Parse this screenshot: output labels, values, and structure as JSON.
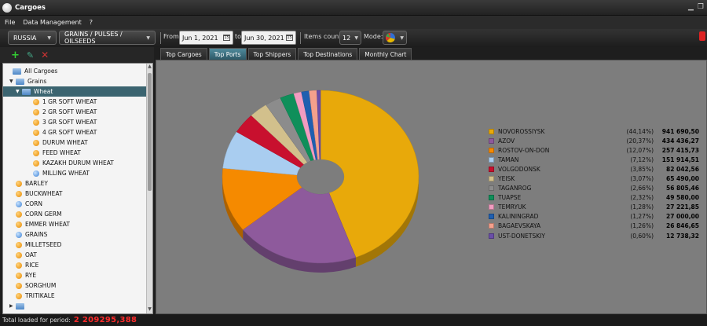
{
  "window": {
    "title": "Cargoes",
    "min_icon": "minimize-icon",
    "restore_icon": "restore-icon"
  },
  "menu": {
    "items": [
      "File",
      "Data Management",
      "?"
    ]
  },
  "toolbar": {
    "country": "RUSSIA",
    "category": "GRAINS / PULSES / OILSEEDS",
    "from_label": "From",
    "from_date": "Jun 1, 2021",
    "to_label": "to",
    "to_date": "Jun 30, 2021",
    "items_count_label": "Items count:",
    "items_count": "12",
    "mode_label": "Mode:",
    "mode_icon": "pie-chart-icon"
  },
  "tree": {
    "items": [
      {
        "label": "All Cargoes",
        "level": 0,
        "icon": "folder",
        "expand": ""
      },
      {
        "label": "Grains",
        "level": 1,
        "icon": "folder",
        "expand": "▼"
      },
      {
        "label": "Wheat",
        "level": 2,
        "icon": "folder",
        "expand": "▼",
        "selected": true
      },
      {
        "label": "1 GR SOFT WHEAT",
        "level": 3,
        "icon": "orange"
      },
      {
        "label": "2 GR SOFT WHEAT",
        "level": 3,
        "icon": "orange"
      },
      {
        "label": "3 GR SOFT WHEAT",
        "level": 3,
        "icon": "orange"
      },
      {
        "label": "4 GR SOFT WHEAT",
        "level": 3,
        "icon": "orange"
      },
      {
        "label": "DURUM WHEAT",
        "level": 3,
        "icon": "orange"
      },
      {
        "label": "FEED WHEAT",
        "level": 3,
        "icon": "orange"
      },
      {
        "label": "KAZAKH DURUM WHEAT",
        "level": 3,
        "icon": "orange"
      },
      {
        "label": "MILLING WHEAT",
        "level": 3,
        "icon": "blue"
      },
      {
        "label": "BARLEY",
        "level": 2,
        "icon": "orange"
      },
      {
        "label": "BUCKWHEAT",
        "level": 2,
        "icon": "orange"
      },
      {
        "label": "CORN",
        "level": 2,
        "icon": "blue"
      },
      {
        "label": "CORN GERM",
        "level": 2,
        "icon": "orange"
      },
      {
        "label": "EMMER WHEAT",
        "level": 2,
        "icon": "orange"
      },
      {
        "label": "GRAINS",
        "level": 2,
        "icon": "blue"
      },
      {
        "label": "MILLETSEED",
        "level": 2,
        "icon": "orange"
      },
      {
        "label": "OAT",
        "level": 2,
        "icon": "orange"
      },
      {
        "label": "RICE",
        "level": 2,
        "icon": "orange"
      },
      {
        "label": "RYE",
        "level": 2,
        "icon": "orange"
      },
      {
        "label": "SORGHUM",
        "level": 2,
        "icon": "orange"
      },
      {
        "label": "TRITIKALE",
        "level": 2,
        "icon": "orange"
      },
      {
        "label": "",
        "level": 1,
        "icon": "folder",
        "expand": "▶"
      }
    ]
  },
  "tabs": [
    {
      "label": "Top Cargoes",
      "active": false
    },
    {
      "label": "Top Ports",
      "active": true
    },
    {
      "label": "Top Shippers",
      "active": false
    },
    {
      "label": "Top Destinations",
      "active": false
    },
    {
      "label": "Monthly Chart",
      "active": false
    }
  ],
  "status": {
    "label": "Total loaded for period:",
    "value": "2 209295,388"
  },
  "chart_data": {
    "type": "pie",
    "title": "",
    "donut": true,
    "legend_position": "right",
    "series": [
      {
        "name": "NOVOROSSIYSK",
        "pct_label": "(44,14%)",
        "value_label": "941 690,50",
        "value": 941690.5,
        "color": "#e8a90a"
      },
      {
        "name": "AZOV",
        "pct_label": "(20,37%)",
        "value_label": "434 436,27",
        "value": 434436.27,
        "color": "#8e5a9c"
      },
      {
        "name": "ROSTOV-ON-DON",
        "pct_label": "(12,07%)",
        "value_label": "257 415,73",
        "value": 257415.73,
        "color": "#f58a00"
      },
      {
        "name": "TAMAN",
        "pct_label": "(7,12%)",
        "value_label": "151 914,51",
        "value": 151914.51,
        "color": "#a9cdf0"
      },
      {
        "name": "VOLGODONSK",
        "pct_label": "(3,85%)",
        "value_label": "82 042,56",
        "value": 82042.56,
        "color": "#c8102e"
      },
      {
        "name": "YEISK",
        "pct_label": "(3,07%)",
        "value_label": "65 490,00",
        "value": 65490.0,
        "color": "#d2c08c"
      },
      {
        "name": "TAGANROG",
        "pct_label": "(2,66%)",
        "value_label": "56 805,46",
        "value": 56805.46,
        "color": "#8c8c8c"
      },
      {
        "name": "TUAPSE",
        "pct_label": "(2,32%)",
        "value_label": "49 580,00",
        "value": 49580.0,
        "color": "#0f8f5a"
      },
      {
        "name": "TEMRYUK",
        "pct_label": "(1,28%)",
        "value_label": "27 221,85",
        "value": 27221.85,
        "color": "#f29cc0"
      },
      {
        "name": "KALININGRAD",
        "pct_label": "(1,27%)",
        "value_label": "27 000,00",
        "value": 27000.0,
        "color": "#1f5fb0"
      },
      {
        "name": "BAGAEVSKAYA",
        "pct_label": "(1,26%)",
        "value_label": "26 846,65",
        "value": 26846.65,
        "color": "#f5a08c"
      },
      {
        "name": "UST-DONETSKIY",
        "pct_label": "(0,60%)",
        "value_label": "12 738,32",
        "value": 12738.32,
        "color": "#6a4ea8"
      }
    ]
  }
}
